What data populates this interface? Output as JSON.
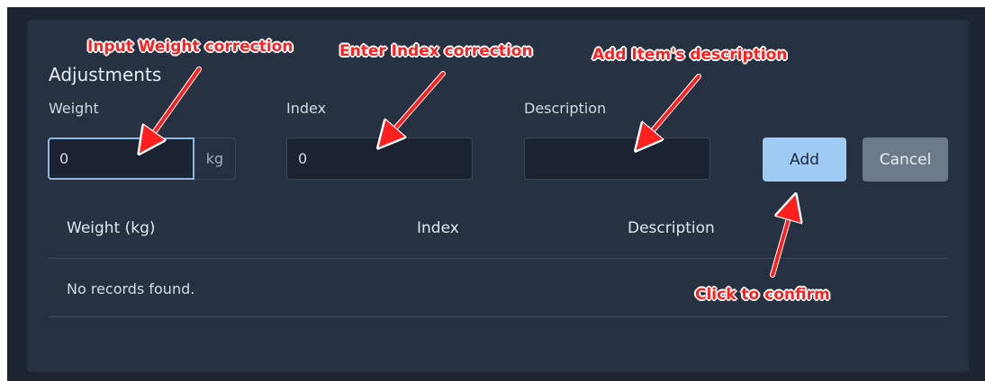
{
  "panel": {
    "title": "Adjustments",
    "fields": {
      "weight": {
        "label": "Weight",
        "value": "0",
        "unit": "kg"
      },
      "index": {
        "label": "Index",
        "value": "0"
      },
      "description": {
        "label": "Description",
        "value": ""
      }
    },
    "buttons": {
      "add": "Add",
      "cancel": "Cancel"
    },
    "table": {
      "columns": [
        "Weight (kg)",
        "Index",
        "Description"
      ],
      "empty_message": "No records found."
    }
  },
  "annotations": {
    "weight": "Input Weight correction",
    "index": "Enter Index correction",
    "description": "Add Item's description",
    "confirm": "Click to confirm",
    "color": "#ff1f1f"
  },
  "colors": {
    "background": "#1c2331",
    "card": "#263141",
    "add_button": "#9ecbf4",
    "cancel_button": "#6c7b8a"
  }
}
